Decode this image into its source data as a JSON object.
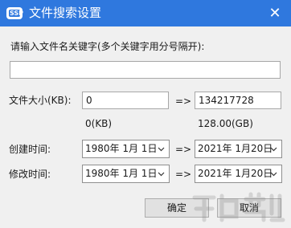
{
  "window": {
    "title": "文件搜索设置",
    "app_icon": "app-logo-icon",
    "close_glyph": "✕"
  },
  "keyword": {
    "label": "请输入文件名关键字(多个关键字用分号隔开):",
    "value": ""
  },
  "size": {
    "label": "文件大小(KB):",
    "min_value": "0",
    "arrow": "=>",
    "max_value": "134217728",
    "min_hint": "0(KB)",
    "max_hint": "128.00(GB)"
  },
  "created": {
    "label": "创建时间:",
    "from": "1980年  1月  1日",
    "arrow": "=>",
    "to": "2021年  1月20日"
  },
  "modified": {
    "label": "修改时间:",
    "from": "1980年  1月  1日",
    "arrow": "=>",
    "to": "2021年  1月20日"
  },
  "buttons": {
    "ok": "确定",
    "cancel": "取消"
  },
  "colors": {
    "titlebar": "#2f78de",
    "dialog_bg": "#f0f0f0"
  }
}
